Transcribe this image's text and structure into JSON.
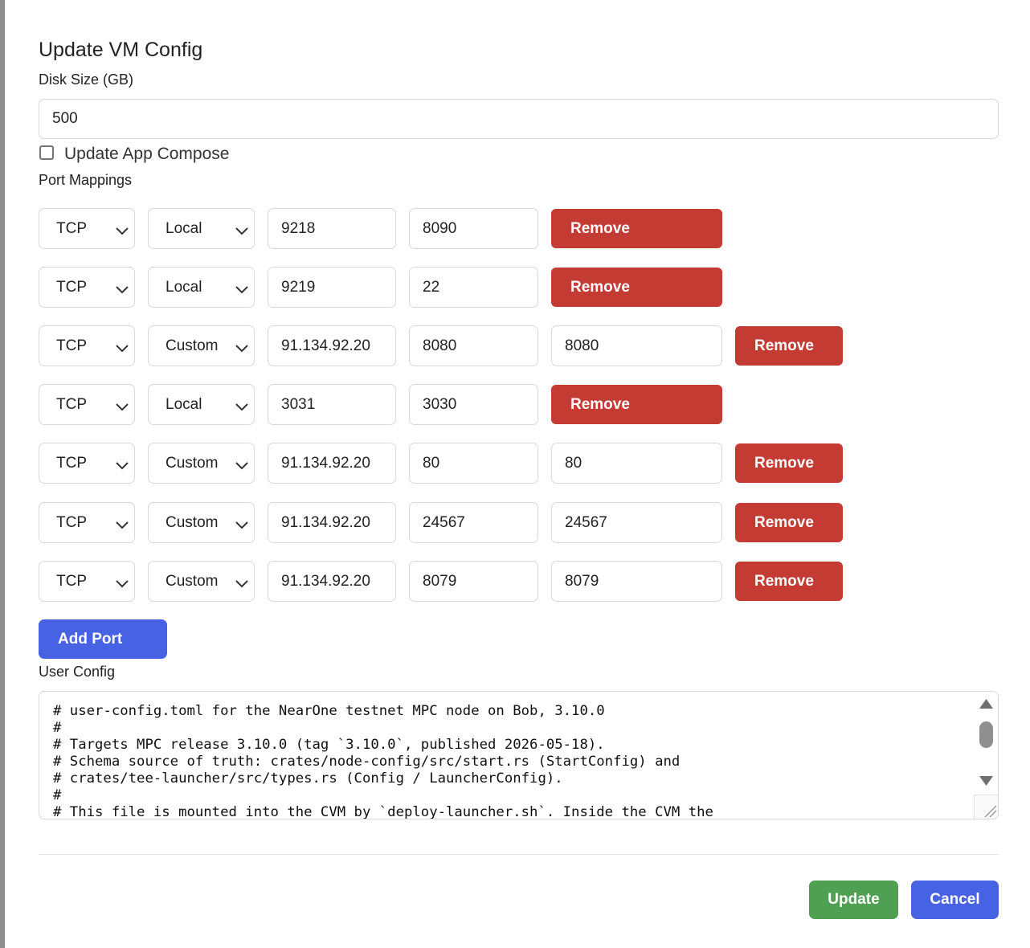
{
  "dialog": {
    "title": "Update VM Config",
    "disk_size_label": "Disk Size (GB)",
    "disk_size_value": "500",
    "update_app_compose_label": "Update App Compose",
    "update_app_compose_checked": false,
    "port_mappings_label": "Port Mappings",
    "port_mappings": [
      {
        "protocol": "TCP",
        "mode": "Local",
        "host_port": "9218",
        "vm_port": "8090",
        "remove_label": "Remove"
      },
      {
        "protocol": "TCP",
        "mode": "Local",
        "host_port": "9219",
        "vm_port": "22",
        "remove_label": "Remove"
      },
      {
        "protocol": "TCP",
        "mode": "Custom",
        "address": "91.134.92.20",
        "host_port": "8080",
        "vm_port": "8080",
        "remove_label": "Remove"
      },
      {
        "protocol": "TCP",
        "mode": "Local",
        "host_port": "3031",
        "vm_port": "3030",
        "remove_label": "Remove"
      },
      {
        "protocol": "TCP",
        "mode": "Custom",
        "address": "91.134.92.20",
        "host_port": "80",
        "vm_port": "80",
        "remove_label": "Remove"
      },
      {
        "protocol": "TCP",
        "mode": "Custom",
        "address": "91.134.92.20",
        "host_port": "24567",
        "vm_port": "24567",
        "remove_label": "Remove"
      },
      {
        "protocol": "TCP",
        "mode": "Custom",
        "address": "91.134.92.20",
        "host_port": "8079",
        "vm_port": "8079",
        "remove_label": "Remove"
      }
    ],
    "add_port_label": "Add Port",
    "user_config_label": "User Config",
    "user_config_lines": [
      "# user-config.toml for the NearOne testnet MPC node on Bob, 3.10.0",
      "#",
      "# Targets MPC release 3.10.0 (tag `3.10.0`, published 2026-05-18).",
      "# Schema source of truth: crates/node-config/src/start.rs (StartConfig) and",
      "# crates/tee-launcher/src/types.rs (Config / LauncherConfig).",
      "#",
      "# This file is mounted into the CVM by `deploy-launcher.sh`. Inside the CVM the"
    ],
    "update_label": "Update",
    "cancel_label": "Cancel"
  },
  "colors": {
    "remove": "#c43b33",
    "primary": "#4763e4",
    "update": "#4fa053"
  }
}
